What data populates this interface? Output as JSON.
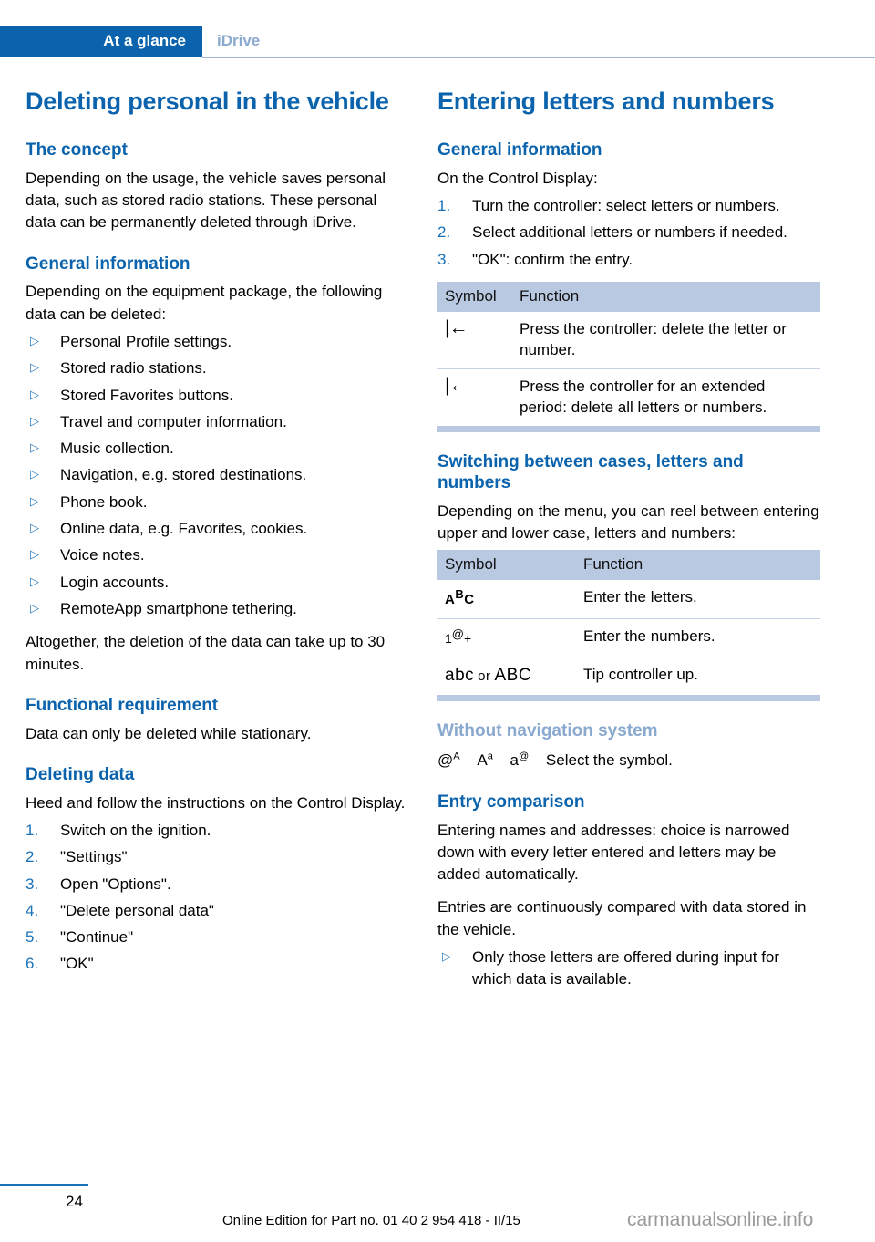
{
  "header": {
    "active_tab": "At a glance",
    "inactive_tab": "iDrive"
  },
  "left_column": {
    "title": "Deleting personal in the vehicle",
    "sections": [
      {
        "heading": "The concept",
        "paragraph": "Depending on the usage, the vehicle saves personal data, such as stored radio stations. These personal data can be permanently deleted through iDrive."
      },
      {
        "heading": "General information",
        "paragraph": "Depending on the equipment package, the following data can be deleted:",
        "bullets": [
          "Personal Profile settings.",
          "Stored radio stations.",
          "Stored Favorites buttons.",
          "Travel and computer information.",
          "Music collection.",
          "Navigation, e.g. stored destinations.",
          "Phone book.",
          "Online data, e.g. Favorites, cookies.",
          "Voice notes.",
          "Login accounts.",
          "RemoteApp smartphone tethering."
        ],
        "closing_paragraph": "Altogether, the deletion of the data can take up to 30 minutes."
      },
      {
        "heading": "Functional requirement",
        "paragraph": "Data can only be deleted while stationary."
      },
      {
        "heading": "Deleting data",
        "paragraph": "Heed and follow the instructions on the Control Display.",
        "steps": [
          {
            "num": "1.",
            "text": "Switch on the ignition."
          },
          {
            "num": "2.",
            "text": "\"Settings\""
          },
          {
            "num": "3.",
            "text": "Open \"Options\"."
          },
          {
            "num": "4.",
            "text": "\"Delete personal data\""
          },
          {
            "num": "5.",
            "text": "\"Continue\""
          },
          {
            "num": "6.",
            "text": "\"OK\""
          }
        ]
      }
    ]
  },
  "right_column": {
    "title": "Entering letters and numbers",
    "general_information": {
      "heading": "General information",
      "paragraph": "On the Control Display:",
      "steps": [
        {
          "num": "1.",
          "text": "Turn the controller: select letters or numbers."
        },
        {
          "num": "2.",
          "text": "Select additional letters or numbers if needed."
        },
        {
          "num": "3.",
          "text": "\"OK\": confirm the entry."
        }
      ]
    },
    "table_delete": {
      "columns": [
        "Symbol",
        "Function"
      ],
      "rows": [
        {
          "symbol": "|←",
          "symbol_name": "backspace-icon",
          "function": "Press the controller: delete the letter or number."
        },
        {
          "symbol": "|←",
          "symbol_name": "backspace-icon",
          "function": "Press the controller for an extended period: delete all letters or numbers."
        }
      ]
    },
    "switching": {
      "heading": "Switching between cases, letters and numbers",
      "paragraph": "Depending on the menu, you can reel between entering upper and lower case, letters and numbers:"
    },
    "table_switching": {
      "columns": [
        "Symbol",
        "Function"
      ],
      "rows": [
        {
          "symbol_base": "A",
          "symbol_sup": "B",
          "symbol_tail": "C",
          "symbol_name": "abc-letters-icon",
          "function": "Enter the letters."
        },
        {
          "symbol_base": "1",
          "symbol_sup": "@",
          "symbol_tail": "+",
          "symbol_name": "numbers-icon",
          "function": "Enter the numbers."
        },
        {
          "symbol_lower": "abc",
          "symbol_sep": "or",
          "symbol_upper": "ABC",
          "symbol_name": "case-toggle-icon",
          "function": "Tip controller up."
        }
      ]
    },
    "without_nav": {
      "heading": "Without navigation system",
      "symbols": [
        {
          "base": "@",
          "sup": "A",
          "name": "at-uppercase-icon"
        },
        {
          "base": "A",
          "sup": "a",
          "name": "uppercase-lowercase-icon"
        },
        {
          "base": "a",
          "sup": "@",
          "name": "lowercase-at-icon"
        }
      ],
      "caption": "Select the symbol."
    },
    "entry_comparison": {
      "heading": "Entry comparison",
      "paragraph1": "Entering names and addresses: choice is narrowed down with every letter entered and letters may be added automatically.",
      "paragraph2": "Entries are continuously compared with data stored in the vehicle.",
      "bullets": [
        "Only those letters are offered during input for which data is available."
      ]
    }
  },
  "footer": {
    "page_number": "24",
    "edition_note": "Online Edition for Part no. 01 40 2 954 418 - II/15",
    "watermark": "carmanualsonline.info"
  }
}
